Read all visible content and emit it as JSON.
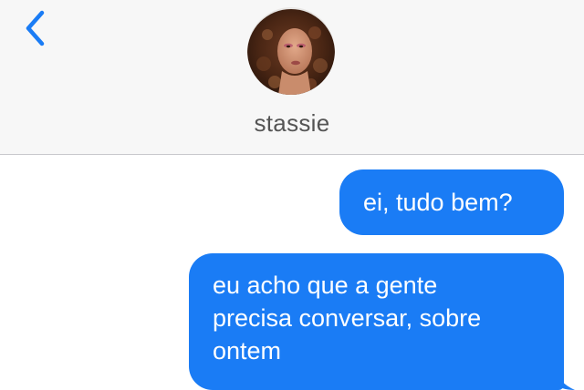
{
  "header": {
    "contact_name": "stassie",
    "back_icon": "chevron-left-icon",
    "accent_color": "#1a7cf5"
  },
  "messages": [
    {
      "direction": "outgoing",
      "lines": [
        "ei, tudo bem?"
      ]
    },
    {
      "direction": "outgoing",
      "lines": [
        "eu acho que a gente",
        "precisa conversar, sobre",
        "ontem"
      ]
    }
  ],
  "colors": {
    "bubble_blue": "#1a7cf5",
    "header_bg": "#f7f7f7",
    "name_text": "#555555"
  }
}
